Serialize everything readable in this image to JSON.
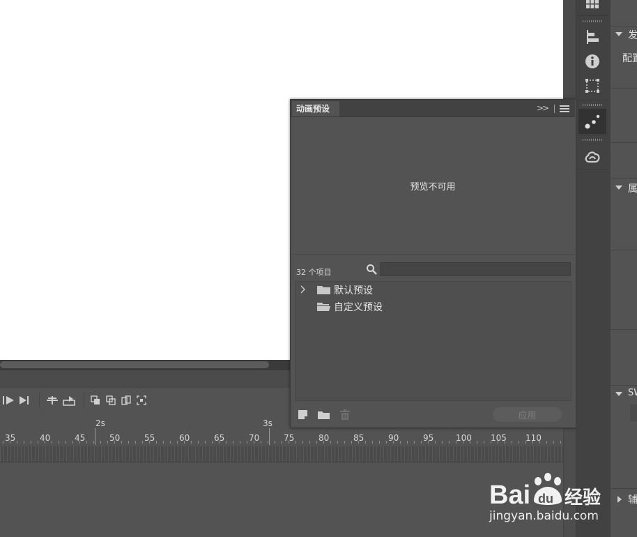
{
  "panel": {
    "title": "动画预设",
    "preview_message": "预览不可用",
    "item_count": "32 个项目",
    "search_placeholder": "",
    "tree": [
      {
        "label": "默认预设",
        "expandable": true
      },
      {
        "label": "自定义预设",
        "expandable": false
      }
    ],
    "apply_label": "应用"
  },
  "timeline": {
    "seconds_labels": [
      "2s",
      "3s"
    ],
    "frame_labels": [
      "35",
      "40",
      "45",
      "50",
      "55",
      "60",
      "65",
      "70",
      "75",
      "80",
      "85",
      "90",
      "95",
      "100",
      "105",
      "110"
    ]
  },
  "properties": {
    "publish_label": "发",
    "profile_label": "配置",
    "attr_label": "属",
    "swf_label": "SW",
    "aux_label": "辅"
  },
  "watermark": {
    "brand": "Bai du 经验",
    "url": "jingyan.baidu.com"
  },
  "colors": {
    "panel_bg": "#535353",
    "header_bg": "#424242",
    "stage_bg": "#ffffff"
  }
}
